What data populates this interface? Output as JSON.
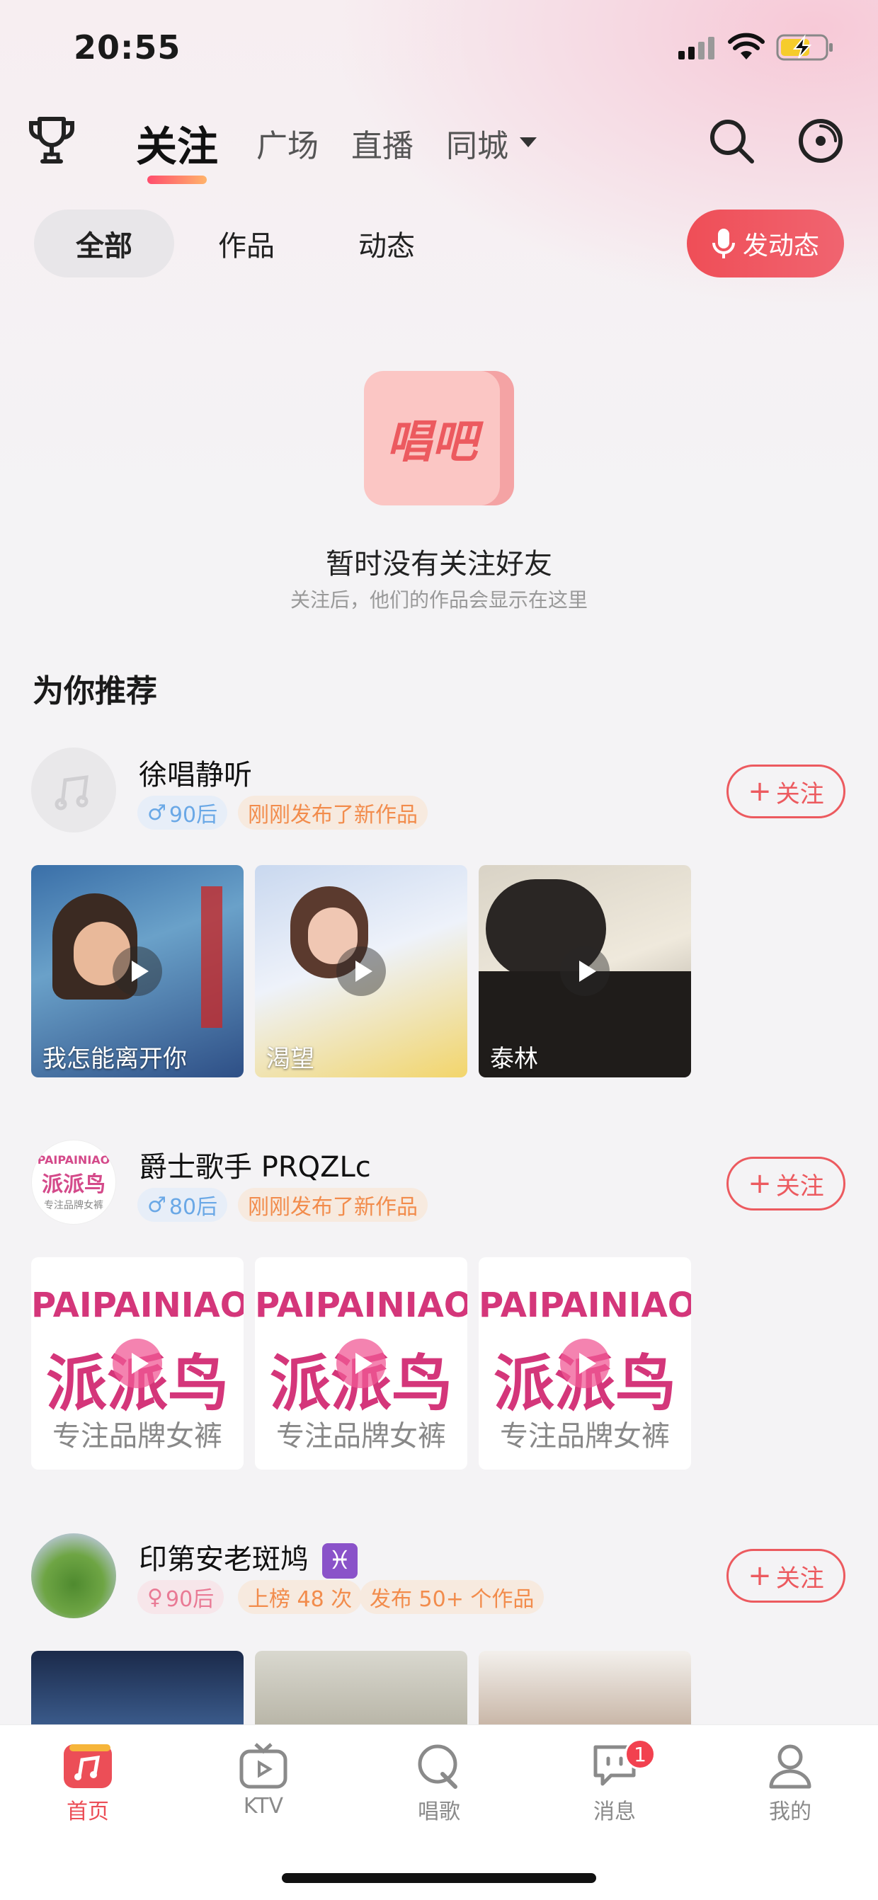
{
  "status": {
    "time": "20:55"
  },
  "nav": {
    "tabs": [
      "关注",
      "广场",
      "直播",
      "同城"
    ]
  },
  "filters": {
    "tabs": [
      "全部",
      "作品",
      "动态"
    ],
    "post_button": "发动态"
  },
  "empty_state": {
    "logo_text": "唱吧",
    "title": "暂时没有关注好友",
    "subtitle": "关注后，他们的作品会显示在这里"
  },
  "recommend": {
    "title": "为你推荐",
    "follow_label": "关注",
    "users": [
      {
        "name": "徐唱静听",
        "gender_icon": "male-icon",
        "age_tag": "90后",
        "tags": [
          "刚刚发布了新作品"
        ],
        "works": [
          "我怎能离开你",
          "渴望",
          "泰林"
        ]
      },
      {
        "name": "爵士歌手 PRQZLc",
        "gender_icon": "male-icon",
        "age_tag": "80后",
        "tags": [
          "刚刚发布了新作品"
        ],
        "avatar_text": [
          "PAIPAINIAO",
          "派派鸟",
          "专注品牌女裤"
        ],
        "works": [
          "PAIPAINIAO",
          "派派鸟",
          "专注品牌女裤"
        ]
      },
      {
        "name": "印第安老斑鸠",
        "zodiac": "♓",
        "gender_icon": "female-icon",
        "age_tag": "90后",
        "tags": [
          "上榜 48 次",
          "发布 50+ 个作品"
        ],
        "works": []
      }
    ]
  },
  "tabbar": {
    "items": [
      "首页",
      "KTV",
      "唱歌",
      "消息",
      "我的"
    ],
    "badge": "1"
  },
  "colors": {
    "accent": "#ec4e57",
    "background": "#f4f3f5"
  }
}
